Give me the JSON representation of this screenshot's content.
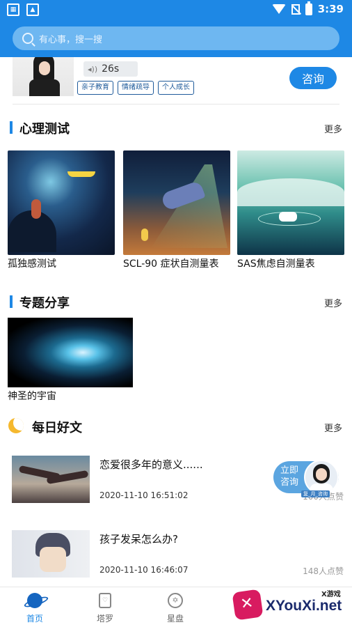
{
  "status_bar": {
    "time": "3:39"
  },
  "search": {
    "placeholder": "有心事，搜一搜"
  },
  "counselor": {
    "voice_duration": "26s",
    "tags": [
      "亲子教育",
      "情绪疏导",
      "个人成长"
    ],
    "consult_label": "咨询"
  },
  "sections": {
    "tests": {
      "title": "心理测试",
      "more": "更多"
    },
    "topics": {
      "title": "专题分享",
      "more": "更多"
    },
    "daily": {
      "title": "每日好文",
      "more": "更多"
    }
  },
  "tests": [
    {
      "label": "孤独感测试"
    },
    {
      "label": "SCL-90 症状自测量表"
    },
    {
      "label": "SAS焦虑自测量表"
    }
  ],
  "topics": [
    {
      "label": "神圣的宇宙"
    }
  ],
  "articles": [
    {
      "title": "恋爱很多年的意义......",
      "time": "2020-11-10 16:51:02",
      "likes": "100人点赞"
    },
    {
      "title": "孩子发呆怎么办?",
      "time": "2020-11-10 16:46:07",
      "likes": "148人点赞"
    }
  ],
  "float_consult": {
    "label": "立即咨询",
    "avatar_name": "复_月_咨询"
  },
  "tabbar": [
    {
      "label": "首页"
    },
    {
      "label": "塔罗"
    },
    {
      "label": "星盘"
    }
  ],
  "watermark": {
    "small": "X游戏",
    "big": "XYouXi.net"
  },
  "colors": {
    "primary": "#1e88e5",
    "search_bg": "#6eb7f1",
    "watermark_pink": "#d81b60"
  }
}
